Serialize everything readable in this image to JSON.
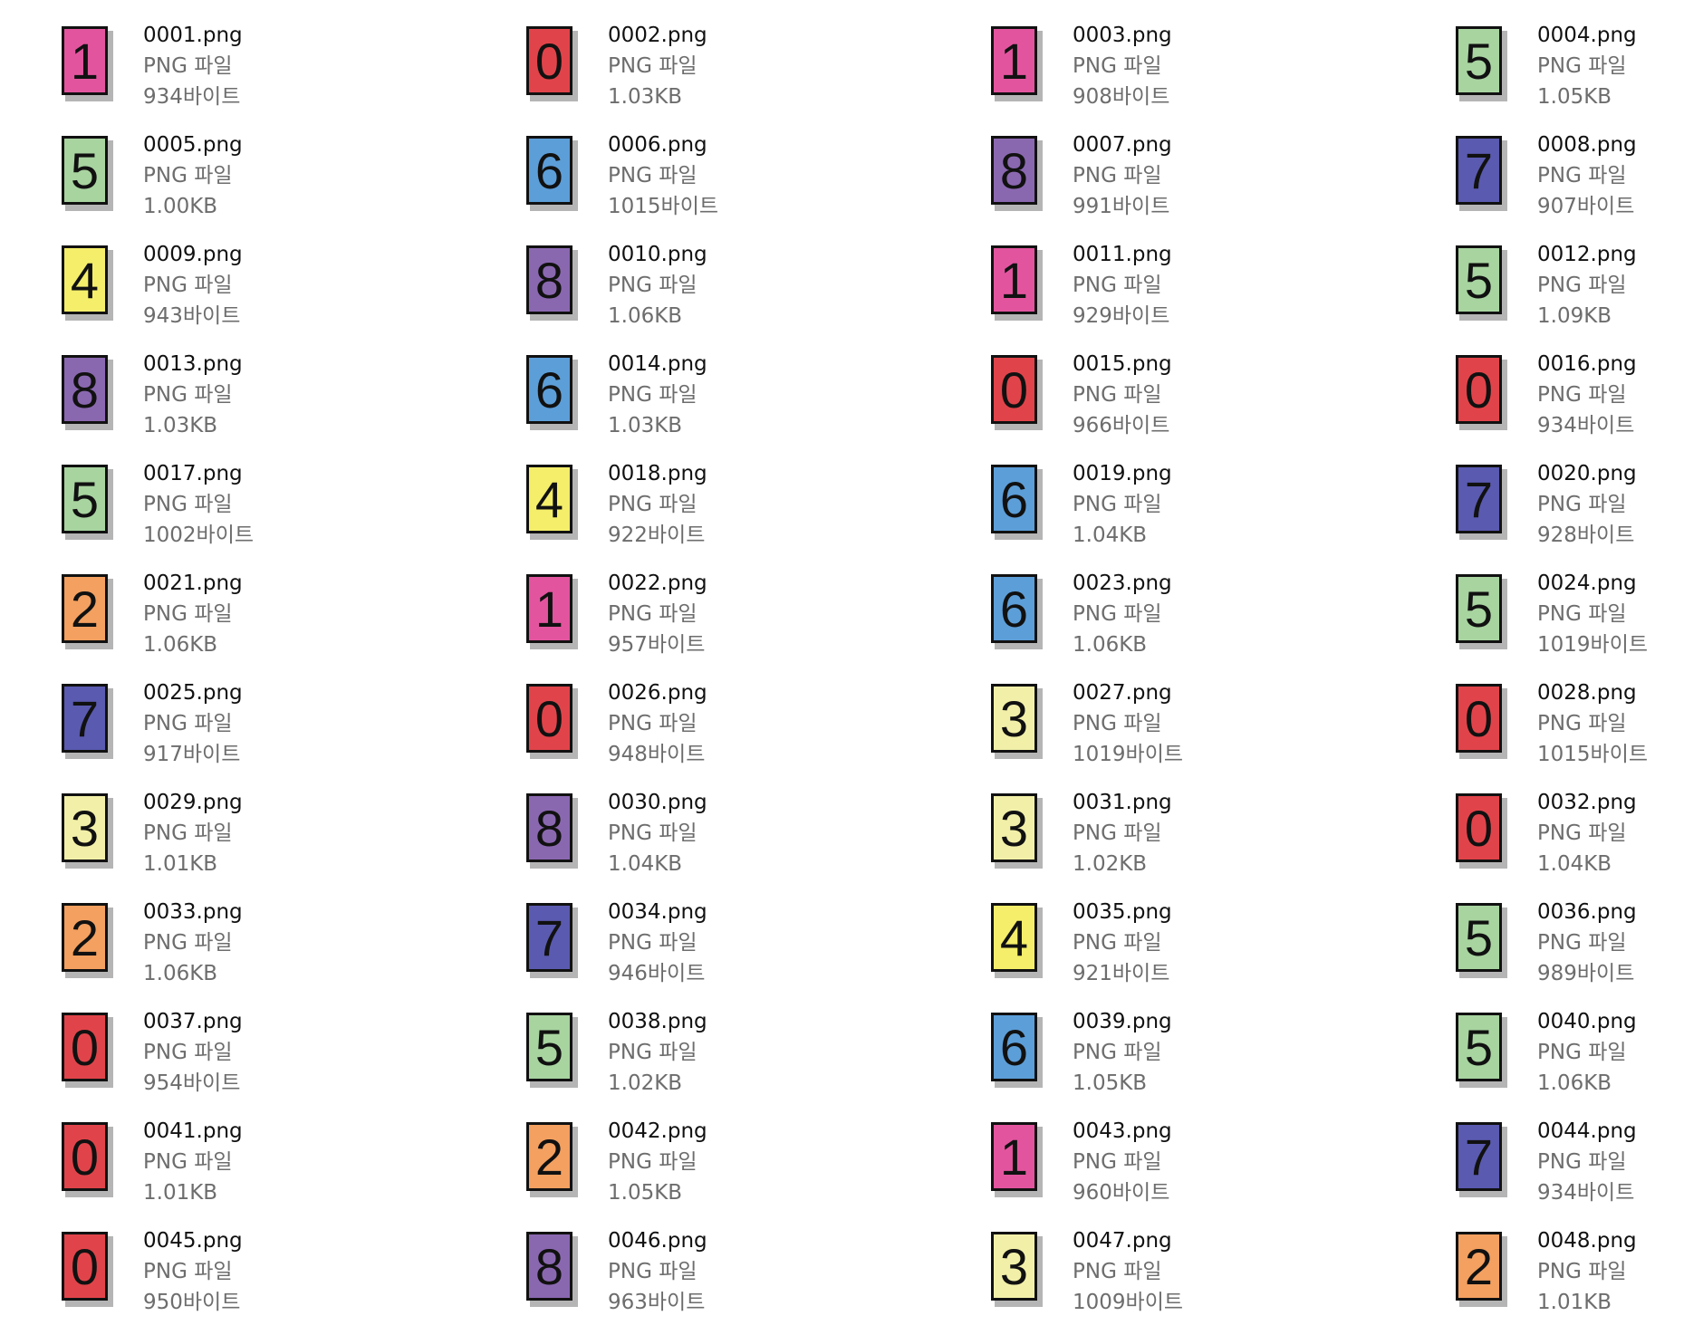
{
  "colors": {
    "0": "#e0444a",
    "1": "#e2559e",
    "2": "#f3a060",
    "3": "#f2f0a8",
    "4": "#f4ee6a",
    "5": "#a8d4a0",
    "6": "#5c9ed8",
    "7": "#5a5ab0",
    "8": "#8a68b0"
  },
  "files": [
    {
      "name": "0001.png",
      "type": "PNG 파일",
      "size": "934바이트",
      "digit": "1"
    },
    {
      "name": "0002.png",
      "type": "PNG 파일",
      "size": "1.03KB",
      "digit": "0"
    },
    {
      "name": "0003.png",
      "type": "PNG 파일",
      "size": "908바이트",
      "digit": "1"
    },
    {
      "name": "0004.png",
      "type": "PNG 파일",
      "size": "1.05KB",
      "digit": "5"
    },
    {
      "name": "0005.png",
      "type": "PNG 파일",
      "size": "1.00KB",
      "digit": "5"
    },
    {
      "name": "0006.png",
      "type": "PNG 파일",
      "size": "1015바이트",
      "digit": "6"
    },
    {
      "name": "0007.png",
      "type": "PNG 파일",
      "size": "991바이트",
      "digit": "8"
    },
    {
      "name": "0008.png",
      "type": "PNG 파일",
      "size": "907바이트",
      "digit": "7"
    },
    {
      "name": "0009.png",
      "type": "PNG 파일",
      "size": "943바이트",
      "digit": "4"
    },
    {
      "name": "0010.png",
      "type": "PNG 파일",
      "size": "1.06KB",
      "digit": "8"
    },
    {
      "name": "0011.png",
      "type": "PNG 파일",
      "size": "929바이트",
      "digit": "1"
    },
    {
      "name": "0012.png",
      "type": "PNG 파일",
      "size": "1.09KB",
      "digit": "5"
    },
    {
      "name": "0013.png",
      "type": "PNG 파일",
      "size": "1.03KB",
      "digit": "8"
    },
    {
      "name": "0014.png",
      "type": "PNG 파일",
      "size": "1.03KB",
      "digit": "6"
    },
    {
      "name": "0015.png",
      "type": "PNG 파일",
      "size": "966바이트",
      "digit": "0"
    },
    {
      "name": "0016.png",
      "type": "PNG 파일",
      "size": "934바이트",
      "digit": "0"
    },
    {
      "name": "0017.png",
      "type": "PNG 파일",
      "size": "1002바이트",
      "digit": "5"
    },
    {
      "name": "0018.png",
      "type": "PNG 파일",
      "size": "922바이트",
      "digit": "4"
    },
    {
      "name": "0019.png",
      "type": "PNG 파일",
      "size": "1.04KB",
      "digit": "6"
    },
    {
      "name": "0020.png",
      "type": "PNG 파일",
      "size": "928바이트",
      "digit": "7"
    },
    {
      "name": "0021.png",
      "type": "PNG 파일",
      "size": "1.06KB",
      "digit": "2"
    },
    {
      "name": "0022.png",
      "type": "PNG 파일",
      "size": "957바이트",
      "digit": "1"
    },
    {
      "name": "0023.png",
      "type": "PNG 파일",
      "size": "1.06KB",
      "digit": "6"
    },
    {
      "name": "0024.png",
      "type": "PNG 파일",
      "size": "1019바이트",
      "digit": "5"
    },
    {
      "name": "0025.png",
      "type": "PNG 파일",
      "size": "917바이트",
      "digit": "7"
    },
    {
      "name": "0026.png",
      "type": "PNG 파일",
      "size": "948바이트",
      "digit": "0"
    },
    {
      "name": "0027.png",
      "type": "PNG 파일",
      "size": "1019바이트",
      "digit": "3"
    },
    {
      "name": "0028.png",
      "type": "PNG 파일",
      "size": "1015바이트",
      "digit": "0"
    },
    {
      "name": "0029.png",
      "type": "PNG 파일",
      "size": "1.01KB",
      "digit": "3"
    },
    {
      "name": "0030.png",
      "type": "PNG 파일",
      "size": "1.04KB",
      "digit": "8"
    },
    {
      "name": "0031.png",
      "type": "PNG 파일",
      "size": "1.02KB",
      "digit": "3"
    },
    {
      "name": "0032.png",
      "type": "PNG 파일",
      "size": "1.04KB",
      "digit": "0"
    },
    {
      "name": "0033.png",
      "type": "PNG 파일",
      "size": "1.06KB",
      "digit": "2"
    },
    {
      "name": "0034.png",
      "type": "PNG 파일",
      "size": "946바이트",
      "digit": "7"
    },
    {
      "name": "0035.png",
      "type": "PNG 파일",
      "size": "921바이트",
      "digit": "4"
    },
    {
      "name": "0036.png",
      "type": "PNG 파일",
      "size": "989바이트",
      "digit": "5"
    },
    {
      "name": "0037.png",
      "type": "PNG 파일",
      "size": "954바이트",
      "digit": "0"
    },
    {
      "name": "0038.png",
      "type": "PNG 파일",
      "size": "1.02KB",
      "digit": "5"
    },
    {
      "name": "0039.png",
      "type": "PNG 파일",
      "size": "1.05KB",
      "digit": "6"
    },
    {
      "name": "0040.png",
      "type": "PNG 파일",
      "size": "1.06KB",
      "digit": "5"
    },
    {
      "name": "0041.png",
      "type": "PNG 파일",
      "size": "1.01KB",
      "digit": "0"
    },
    {
      "name": "0042.png",
      "type": "PNG 파일",
      "size": "1.05KB",
      "digit": "2"
    },
    {
      "name": "0043.png",
      "type": "PNG 파일",
      "size": "960바이트",
      "digit": "1"
    },
    {
      "name": "0044.png",
      "type": "PNG 파일",
      "size": "934바이트",
      "digit": "7"
    },
    {
      "name": "0045.png",
      "type": "PNG 파일",
      "size": "950바이트",
      "digit": "0"
    },
    {
      "name": "0046.png",
      "type": "PNG 파일",
      "size": "963바이트",
      "digit": "8"
    },
    {
      "name": "0047.png",
      "type": "PNG 파일",
      "size": "1009바이트",
      "digit": "3"
    },
    {
      "name": "0048.png",
      "type": "PNG 파일",
      "size": "1.01KB",
      "digit": "2"
    }
  ]
}
